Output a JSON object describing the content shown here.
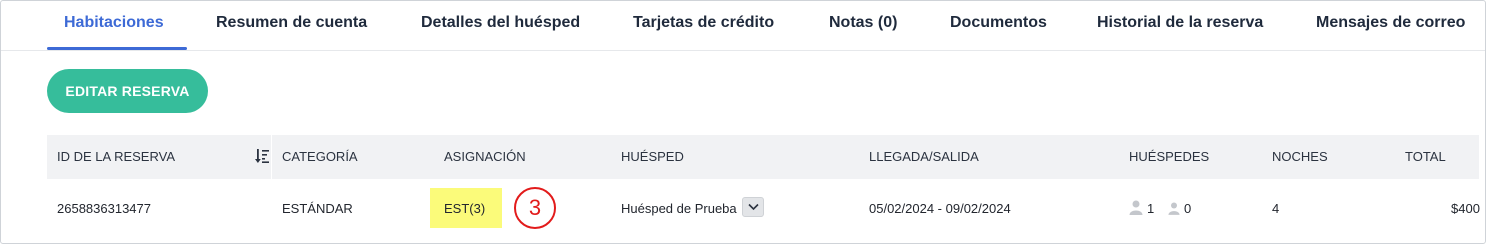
{
  "tabs": [
    {
      "label": "Habitaciones",
      "active": true
    },
    {
      "label": "Resumen de cuenta"
    },
    {
      "label": "Detalles del huésped"
    },
    {
      "label": "Tarjetas de crédito"
    },
    {
      "label": "Notas (0)"
    },
    {
      "label": "Documentos"
    },
    {
      "label": "Historial de la reserva"
    },
    {
      "label": "Mensajes de correo"
    }
  ],
  "edit_button": "EDITAR RESERVA",
  "table": {
    "headers": [
      "ID DE LA RESERVA",
      "CATEGORÍA",
      "ASIGNACIÓN",
      "HUÉSPED",
      "LLEGADA/SALIDA",
      "HUÉSPEDES",
      "NOCHES",
      "TOTAL"
    ],
    "sort_icon": "sort-descending-icon",
    "row": {
      "reservation_id": "2658836313477",
      "category": "ESTÁNDAR",
      "assignment": "EST(3)",
      "guest": "Huésped de Prueba",
      "dates": "05/02/2024 - 09/02/2024",
      "adults": "1",
      "children": "0",
      "nights": "4",
      "total": "$400"
    }
  },
  "annotation": {
    "label": "3",
    "color": "#e21b1b"
  },
  "colors": {
    "accent": "#3d6ad6",
    "button": "#36bd9b",
    "highlight": "#fbfb7a"
  }
}
